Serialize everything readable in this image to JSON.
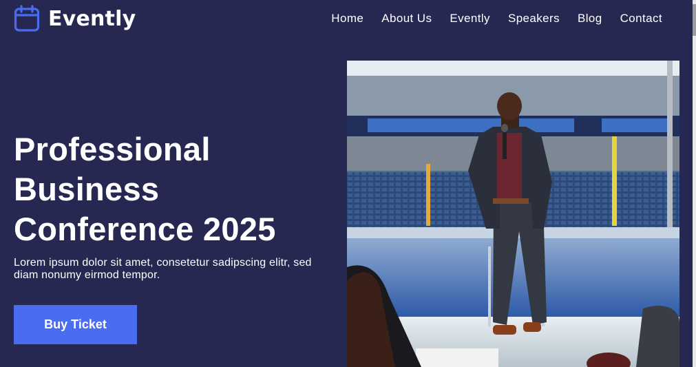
{
  "brand": {
    "name": "Evently",
    "icon": "calendar-icon",
    "color": "#4a6cf0"
  },
  "nav": {
    "items": [
      {
        "label": "Home"
      },
      {
        "label": "About Us"
      },
      {
        "label": "Evently"
      },
      {
        "label": "Speakers"
      },
      {
        "label": "Blog"
      },
      {
        "label": "Contact"
      }
    ]
  },
  "hero": {
    "title": "Professional Business Conference 2025",
    "subtitle": "Lorem ipsum dolor sit amet, consetetur sadipscing elitr, sed diam nonumy eirmod tempor.",
    "cta_label": "Buy Ticket",
    "image": "speaker-on-stage-photo"
  },
  "colors": {
    "background": "#262851",
    "accent": "#4a6cf0",
    "text": "#ffffff"
  }
}
